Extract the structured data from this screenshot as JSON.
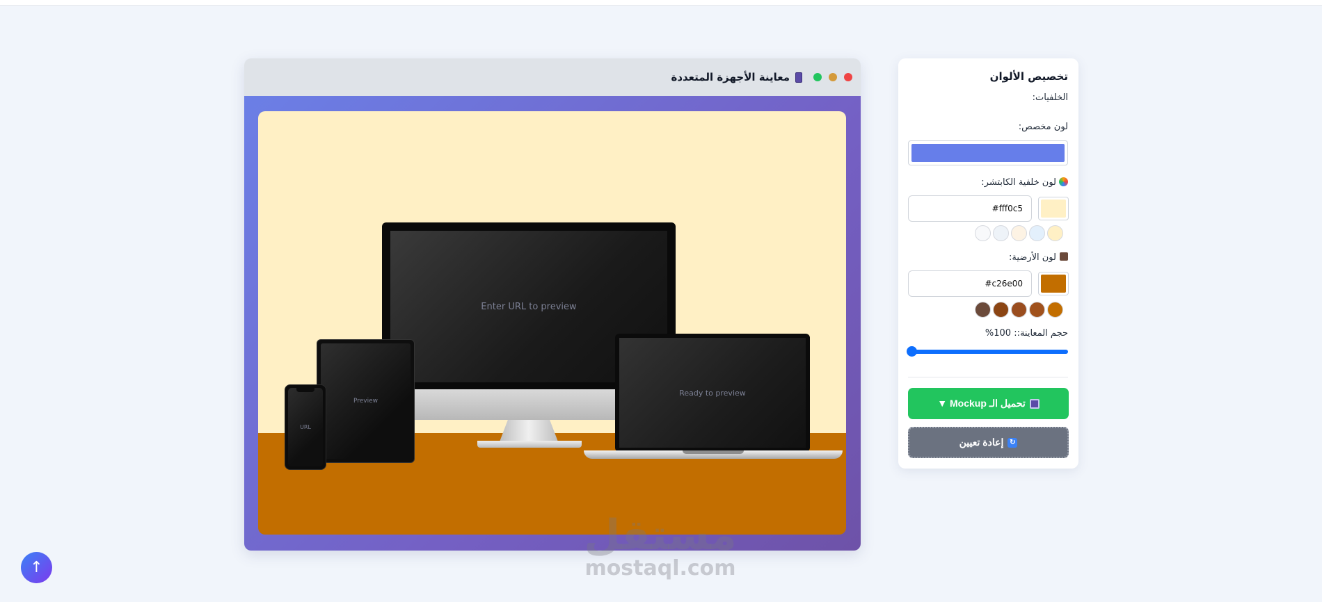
{
  "preview": {
    "title": "معاينة الأجهزة المتعددة",
    "wall_color": "#fff0c5",
    "floor_color": "#c26e00",
    "imac_text": "Enter URL to preview",
    "laptop_text": "Ready to preview",
    "tablet_text": "Preview",
    "phone_text": "URL"
  },
  "panel": {
    "title": "تخصيص الألوان",
    "backgrounds_label": "الخلفيات:",
    "custom_color_label": "لون مخصص:",
    "custom_color": "#667eea",
    "capture_bg_label": "لون خلفية الكابتشر:",
    "capture_bg_hex": "#fff0c5",
    "capture_presets": [
      "#fff0c5",
      "#e3f0fc",
      "#fdf3e4",
      "#eef3f8",
      "#f8f9fb"
    ],
    "floor_label": "لون الأرضية:",
    "floor_hex": "#c26e00",
    "floor_presets": [
      "#c26e00",
      "#a0511c",
      "#9a4d1f",
      "#8b4513",
      "#6b4a3a"
    ],
    "size_label": "حجم المعاينة:: 100%",
    "size_value": 100,
    "download_label": "تحميل الـ Mockup ▼",
    "reset_label": "إعادة تعيين"
  },
  "watermark": {
    "arabic": "مستقل",
    "latin": "mostaql.com"
  },
  "icons": {
    "scroll_top": "arrow-up-icon"
  }
}
